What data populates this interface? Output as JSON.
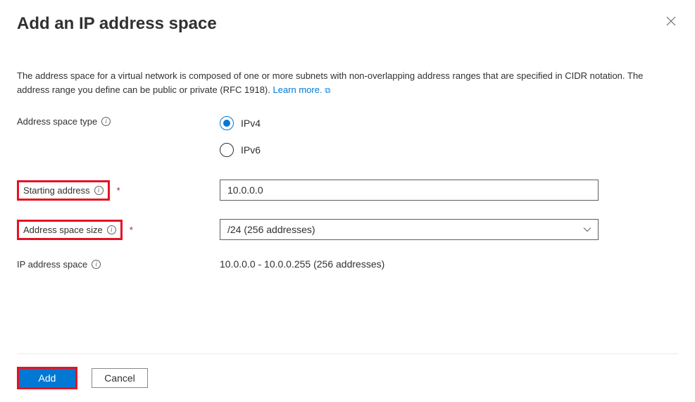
{
  "title": "Add an IP address space",
  "description_prefix": "The address space for a virtual network is composed of one or more subnets with non-overlapping address ranges that are specified in CIDR notation. The address range you define can be public or private (RFC 1918). ",
  "learn_more_label": "Learn more.",
  "labels": {
    "address_space_type": "Address space type",
    "starting_address": "Starting address",
    "address_space_size": "Address space size",
    "ip_address_space": "IP address space"
  },
  "radio_options": {
    "ipv4": "IPv4",
    "ipv6": "IPv6"
  },
  "fields": {
    "starting_address_value": "10.0.0.0",
    "address_space_size_value": "/24 (256 addresses)",
    "ip_address_space_value": "10.0.0.0 - 10.0.0.255 (256 addresses)"
  },
  "buttons": {
    "add": "Add",
    "cancel": "Cancel"
  }
}
